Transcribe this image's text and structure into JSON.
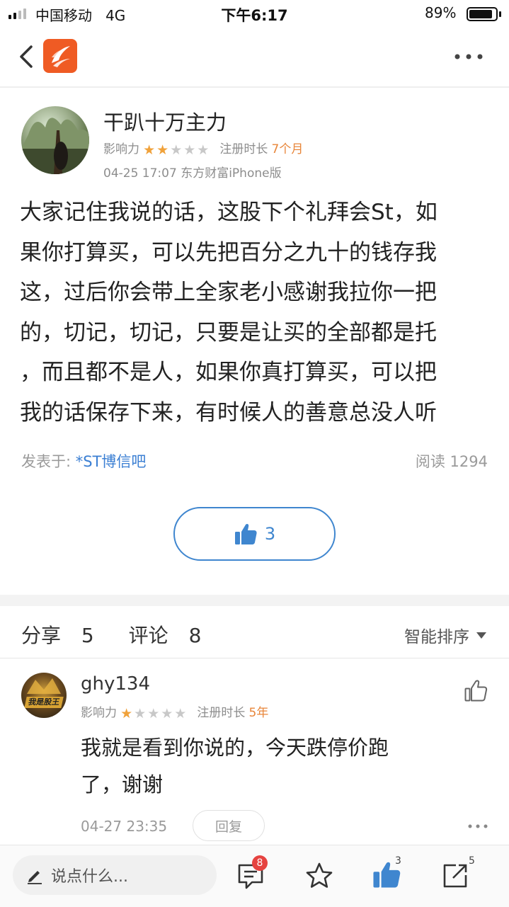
{
  "status_bar": {
    "carrier": "中国移动",
    "network": "4G",
    "time": "下午6:17",
    "battery_pct": "89%",
    "battery_level": 0.89
  },
  "nav": {
    "back_icon": "chevron-left-icon",
    "logo_icon": "eastmoney-logo-icon",
    "more_icon": "more-dots-icon",
    "brand_color": "#ef5b24"
  },
  "post": {
    "author": "干趴十万主力",
    "influence_label": "影响力",
    "influence_stars": 2,
    "influence_max": 5,
    "reg_label": "注册时长",
    "reg_value": "7个月",
    "timestamp": "04-25 17:07 东方财富iPhone版",
    "body_lines": [
      "大家记住我说的话，这股下个礼拜会St，如",
      "果你打算买，可以先把百分之九十的钱存我",
      "这，过后你会带上全家老小感谢我拉你一把",
      "的，切记，切记，只要是让买的全部都是托",
      "，而且都不是人，如果你真打算买，可以把",
      "我的话保存下来，有时候人的善意总没人听"
    ],
    "posted_in_label": "发表于:",
    "forum": "*ST博信吧",
    "read_label": "阅读",
    "read_count": "1294",
    "like_count": "3"
  },
  "tabs": {
    "share_label": "分享",
    "share_count": "5",
    "comment_label": "评论",
    "comment_count": "8",
    "sort_label": "智能排序"
  },
  "comments": [
    {
      "author": "ghy134",
      "avatar_text": "我是股王",
      "influence_label": "影响力",
      "influence_stars": 1,
      "influence_max": 5,
      "reg_label": "注册时长",
      "reg_value": "5年",
      "body_lines": [
        "我就是看到你说的，今天跌停价跑",
        "了，谢谢"
      ],
      "time": "04-27 23:35",
      "reply_label": "回复"
    }
  ],
  "bottom_bar": {
    "input_placeholder": "说点什么...",
    "comment_badge": "8",
    "like_count": "3",
    "share_count": "5"
  },
  "colors": {
    "accent_blue": "#3f86cf",
    "star_on": "#f0a23b",
    "orange_text": "#e8863a",
    "badge_red": "#e64340"
  }
}
